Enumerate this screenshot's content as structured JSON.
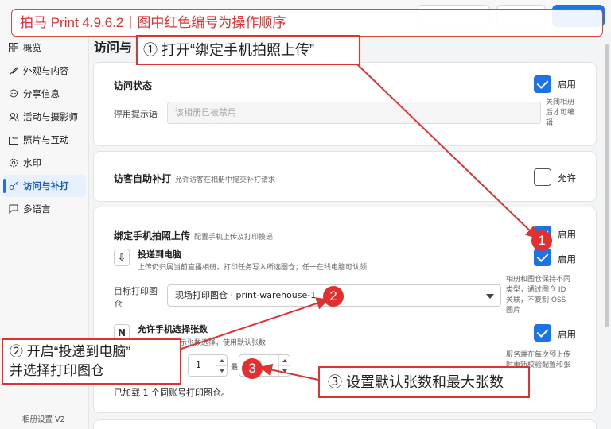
{
  "banner": {
    "text": "拍马 Print 4.9.6.2丨图中红色编号为操作顺序"
  },
  "sidebar": {
    "items": [
      {
        "label": "概览",
        "icon": "grid-icon"
      },
      {
        "label": "外观与内容",
        "icon": "brush-icon"
      },
      {
        "label": "分享信息",
        "icon": "chat-icon"
      },
      {
        "label": "活动与摄影师",
        "icon": "users-icon"
      },
      {
        "label": "照片与互动",
        "icon": "folder-icon"
      },
      {
        "label": "水印",
        "icon": "gear-icon"
      },
      {
        "label": "访问与补打",
        "icon": "key-icon",
        "active": true
      },
      {
        "label": "多语言",
        "icon": "message-icon"
      }
    ],
    "footer": "相册设置 V2"
  },
  "main": {
    "page_title": "访问与",
    "access": {
      "title": "访问状态",
      "enable_label": "启用",
      "enabled": true,
      "side_note": [
        "关闭相册",
        "后才可编",
        "辑"
      ],
      "disable_label": "停用提示语",
      "disable_placeholder": "该相册已被禁用"
    },
    "reprint": {
      "title": "访客自助补打",
      "desc": "允许访客在相册中提交补打请求",
      "allow_label": "允许",
      "allowed": false
    },
    "mobile": {
      "title": "绑定手机拍照上传",
      "desc": "配置手机上传及打印投递",
      "enable_label": "启用",
      "deliver": {
        "icon_letter": "⇩",
        "title": "投递到电脑",
        "desc": "上传仍归属当前直播相册，打印任务写入所选图仓；任一在线电脑可认领",
        "enable_label": "启用"
      },
      "target_label": [
        "目标打印图",
        "仓"
      ],
      "target_value": "现场打印图仓 · print-warehouse-1",
      "target_note": [
        "相册和图仓保持不同",
        "类型，通过图仓 ID",
        "关联，不复制 OSS",
        "图片"
      ],
      "choose": {
        "icon_letter": "N",
        "title": "允许手机选择张数",
        "desc": "示张数选择，使用默认张数",
        "enable_label": "启用",
        "note": [
          "服务端在每次预上传",
          "时重新校验配置和张"
        ]
      },
      "default_count": "1",
      "max_label": "最",
      "loaded_text": "已加载 1 个同账号打印图仓。"
    }
  },
  "annotations": {
    "step1": {
      "text": "① 打开“绑定手机拍照上传”",
      "marker": "1"
    },
    "step2": {
      "text_line1": "② 开启“投递到电脑”",
      "text_line2": "并选择打印图仓",
      "marker": "2"
    },
    "step3": {
      "text": "③ 设置默认张数和最大张数",
      "marker": "3"
    }
  },
  "colors": {
    "accent": "#1a73e8",
    "annotation": "#e03030"
  }
}
